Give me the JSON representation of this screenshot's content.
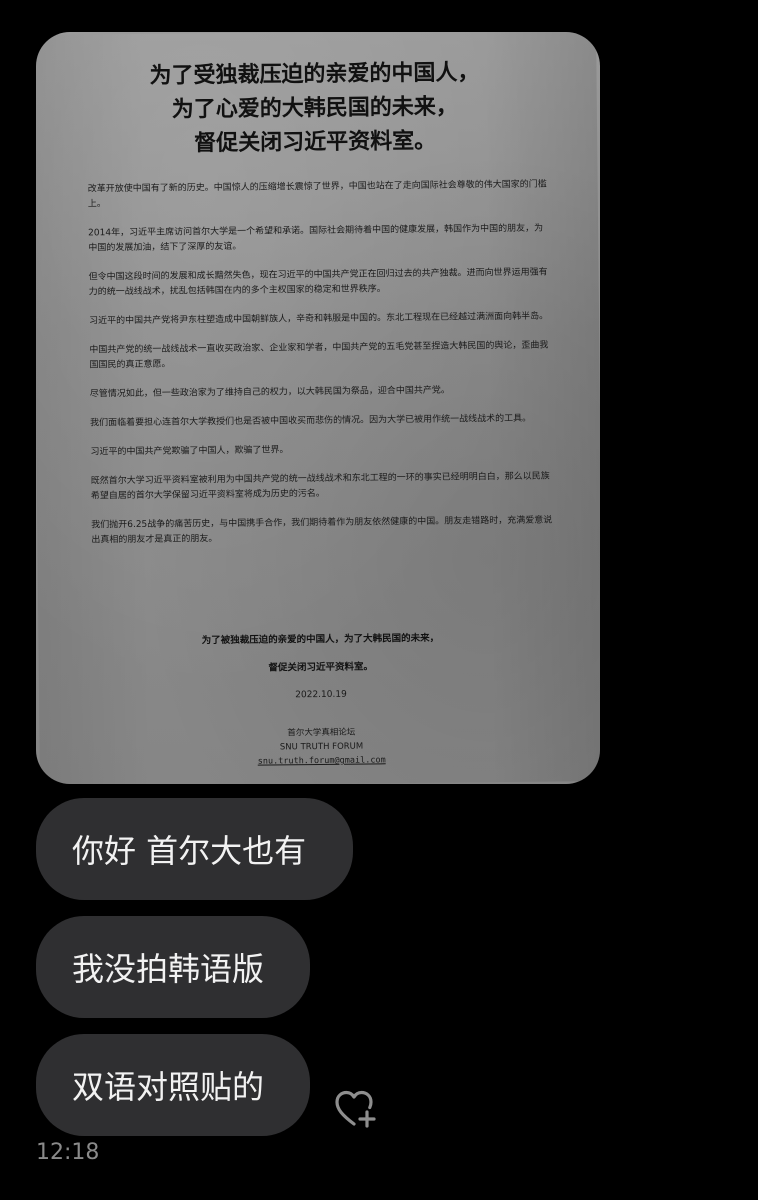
{
  "photo": {
    "title_lines": [
      "为了受独裁压迫的亲爱的中国人，",
      "为了心爱的大韩民国的未来，",
      "督促关闭习近平资料室。"
    ],
    "paragraphs": [
      "改革开放使中国有了新的历史。中国惊人的压缩增长震惊了世界，中国也站在了走向国际社会尊敬的伟大国家的门槛上。",
      "2014年，习近平主席访问首尔大学是一个希望和承诺。国际社会期待着中国的健康发展，韩国作为中国的朋友，为中国的发展加油，结下了深厚的友谊。",
      "但令中国这段时间的发展和成长黯然失色，现在习近平的中国共产党正在回归过去的共产独裁。进而向世界运用强有力的统一战线战术，扰乱包括韩国在内的多个主权国家的稳定和世界秩序。",
      "习近平的中国共产党将尹东柱塑造成中国朝鲜族人，辛奇和韩服是中国的。东北工程现在已经越过满洲面向韩半岛。",
      "中国共产党的统一战线战术一直收买政治家、企业家和学者，中国共产党的五毛党甚至捏造大韩民国的舆论，歪曲我国国民的真正意愿。",
      "尽管情况如此，但一些政治家为了维持自己的权力，以大韩民国为祭品，迎合中国共产党。",
      "我们面临着要担心连首尔大学教授们也是否被中国收买而悲伤的情况。因为大学已被用作统一战线战术的工具。",
      "习近平的中国共产党欺骗了中国人，欺骗了世界。",
      "既然首尔大学习近平资料室被利用为中国共产党的统一战线战术和东北工程的一环的事实已经明明白白，那么以民族希望自居的首尔大学保留习近平资料室将成为历史的污名。",
      "我们抛开6.25战争的痛苦历史，与中国携手合作，我们期待着作为朋友依然健康的中国。朋友走错路时，充满爱意说出真相的朋友才是真正的朋友。"
    ],
    "closing_lines": [
      "为了被独裁压迫的亲爱的中国人，为了大韩民国的未来，",
      "督促关闭习近平资料室。"
    ],
    "date": "2022.10.19",
    "sign_cn": "首尔大学真相论坛",
    "sign_en": "SNU TRUTH FORUM",
    "email": "snu.truth.forum@gmail.com"
  },
  "messages": [
    {
      "text": "你好 首尔大也有"
    },
    {
      "text": "我没拍韩语版"
    },
    {
      "text": "双语对照贴的"
    }
  ],
  "reaction_icon": "heart-plus-icon",
  "timestamp": "12:18",
  "colors": {
    "bubble": "#2f2f31",
    "bubble_text": "#f2f2f2",
    "timestamp": "#8a8a8a",
    "background": "#000000"
  }
}
